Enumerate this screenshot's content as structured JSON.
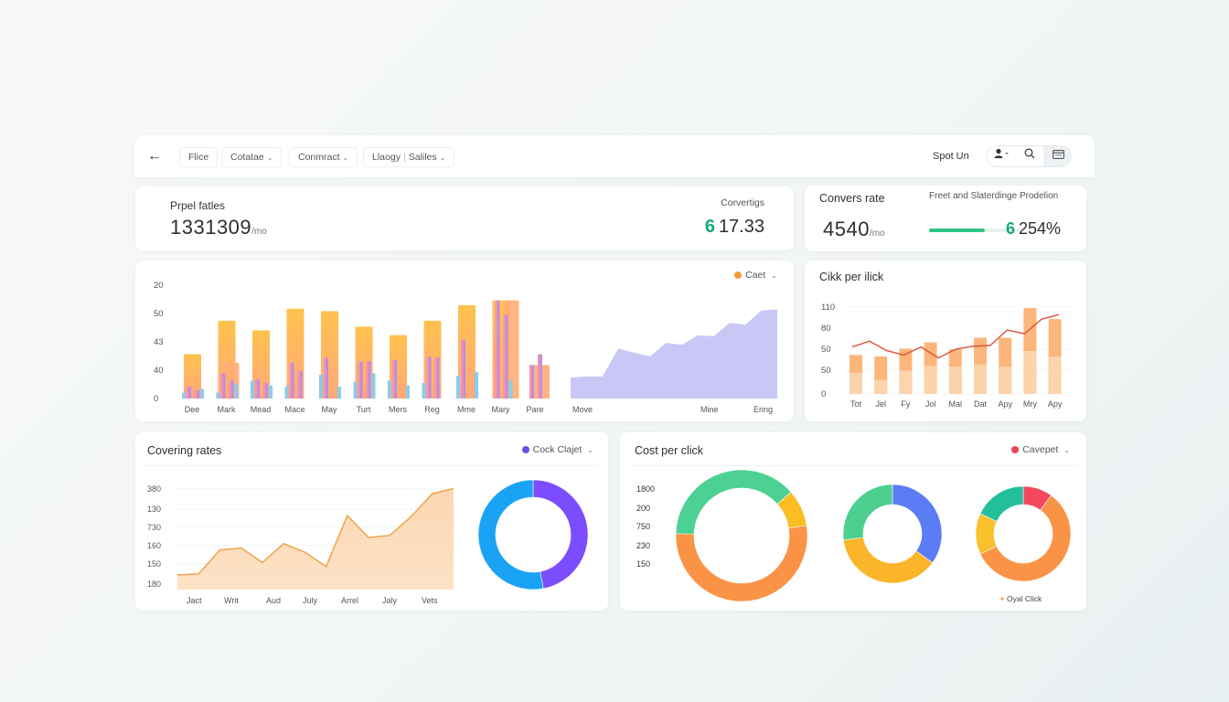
{
  "topbar": {
    "back_icon": "arrow-left-icon",
    "filters": [
      {
        "label": "Flice",
        "has_chevron": false
      },
      {
        "label": "Cotatae",
        "has_chevron": true
      },
      {
        "label": "Conmract",
        "has_chevron": true
      },
      {
        "label": "Llaogy",
        "label2": "Saliles",
        "has_chevron": true
      }
    ],
    "user_name": "Spot Un",
    "tools": [
      {
        "icon": "user-icon",
        "glyph": "👤▾"
      },
      {
        "icon": "search-icon",
        "glyph": "⌕"
      },
      {
        "icon": "window-icon",
        "glyph": "▭"
      }
    ]
  },
  "kpis": {
    "left": {
      "label": "Prpel fatles",
      "value": "1331309",
      "unit": "/mo",
      "right_label": "Corvertigs",
      "right_accent": "6",
      "right_value": "17.33"
    },
    "right": {
      "label": "Convers rate",
      "value": "4540",
      "unit": "/mo",
      "right_label": "Freet and Slaterdinge Prodelion",
      "progress": 0.62,
      "right_accent": "6",
      "right_value": "254%"
    }
  },
  "colors": {
    "accent_green": "#16a974",
    "progress_green": "#2ec486",
    "orange": "#ffb063",
    "orange_light": "#fcd3ab",
    "purple": "#b98de0",
    "pink": "#f291b5",
    "blue": "#8ccbea",
    "lavender": "#c6c4f6",
    "red_line": "#e0503a"
  },
  "chart_data": [
    {
      "id": "main-bars",
      "type": "bar",
      "title": "",
      "legend": {
        "label": "Caet",
        "color": "#f59a3a",
        "placement": "top-right"
      },
      "ytick_labels": [
        "0",
        "40",
        "43",
        "50",
        "20"
      ],
      "ylim": [
        0,
        100
      ],
      "categories": [
        "Dee",
        "Mark",
        "Mead",
        "Mace",
        "May",
        "Turt",
        "Mers",
        "Reg",
        "Mme",
        "Mary",
        "Pare"
      ],
      "series": [
        {
          "name": "orange",
          "values": [
            37,
            65,
            57,
            75,
            73,
            60,
            53,
            65,
            78,
            82,
            0
          ]
        },
        {
          "name": "orange-secondary",
          "values": [
            0,
            30,
            0,
            0,
            0,
            0,
            0,
            0,
            0,
            82,
            28
          ]
        },
        {
          "name": "blue-a",
          "values": [
            5,
            5,
            15,
            10,
            20,
            14,
            15,
            13,
            19,
            0,
            0
          ]
        },
        {
          "name": "pink-purple-a",
          "values": [
            10,
            21,
            16,
            30,
            34,
            31,
            32,
            35,
            49,
            82,
            28
          ]
        },
        {
          "name": "pink-purple-b",
          "values": [
            7,
            15,
            13,
            23,
            0,
            31,
            0,
            34,
            0,
            70,
            37
          ]
        },
        {
          "name": "blue-b",
          "values": [
            8,
            12,
            11,
            0,
            10,
            21,
            11,
            0,
            22,
            15,
            0
          ]
        }
      ],
      "area": {
        "name": "lavender-area",
        "x_labels": [
          "Move",
          "Mine",
          "Ering"
        ],
        "values": [
          22,
          23,
          23,
          52,
          48,
          44,
          58,
          56,
          66,
          65,
          79,
          77,
          92,
          93
        ]
      }
    },
    {
      "id": "click-per-click",
      "type": "bar",
      "title": "Cikk per ilick",
      "ytick_labels": [
        "0",
        "50",
        "50",
        "80",
        "110"
      ],
      "ylim": [
        0,
        110
      ],
      "categories": [
        "Tot",
        "Jel",
        "Fy",
        "Jol",
        "Mal",
        "Dat",
        "Apy",
        "Mry",
        "Apy"
      ],
      "series": [
        {
          "name": "base",
          "values": [
            27,
            18,
            30,
            36,
            35,
            38,
            35,
            55,
            48
          ]
        },
        {
          "name": "top",
          "values": [
            50,
            48,
            58,
            66,
            57,
            72,
            72,
            110,
            96
          ]
        },
        {
          "name": "line",
          "values": [
            64,
            72,
            59,
            53,
            64,
            49,
            61,
            65,
            66,
            87,
            82,
            102,
            108
          ]
        }
      ]
    },
    {
      "id": "covering-rates",
      "type": "area",
      "title": "Covering rates",
      "legend": {
        "label": "Cock Clajet",
        "color": "#6c4ee8",
        "placement": "top-right"
      },
      "ytick_labels": [
        "180",
        "150",
        "160",
        "730",
        "130",
        "380"
      ],
      "x_labels": [
        "Jact",
        "Writ",
        "Aud",
        "July",
        "Arrel",
        "Jaly",
        "Vets"
      ],
      "ylim": [
        0,
        100
      ],
      "values": [
        14,
        15,
        38,
        40,
        26,
        44,
        36,
        22,
        71,
        50,
        52,
        70,
        92,
        97
      ],
      "donut": [
        {
          "label": "purple",
          "value": 47,
          "color": "#7c4dff"
        },
        {
          "label": "blue",
          "value": 53,
          "color": "#1aa3f5"
        }
      ]
    },
    {
      "id": "cost-per-click",
      "type": "pie",
      "title": "Cost per click",
      "legend": {
        "label": "Cavepet",
        "color": "#ef4453",
        "placement": "top-right"
      },
      "ytick_labels": [
        "1800",
        "200",
        "750",
        "230",
        "150"
      ],
      "footer_label": "Oyal Click",
      "footer_color": "#f5a04a",
      "donuts": [
        [
          {
            "value": 53,
            "color": "#fb9347"
          },
          {
            "value": 38,
            "color": "#4cd192"
          },
          {
            "value": 9,
            "color": "#fbbc24"
          }
        ],
        [
          {
            "value": 35,
            "color": "#5b7cf5"
          },
          {
            "value": 38,
            "color": "#fbb52a"
          },
          {
            "value": 27,
            "color": "#4ccf8f"
          }
        ],
        [
          {
            "value": 10,
            "color": "#f5475e"
          },
          {
            "value": 58,
            "color": "#fb9347"
          },
          {
            "value": 14,
            "color": "#fbc12d"
          },
          {
            "value": 18,
            "color": "#22c09a"
          }
        ]
      ]
    }
  ]
}
